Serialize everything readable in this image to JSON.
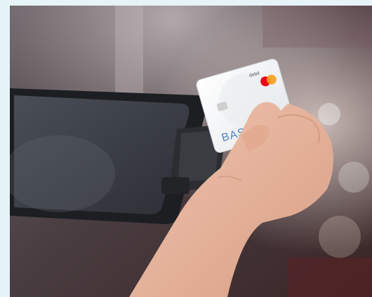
{
  "photo": {
    "card": {
      "brand_text": "BASIC",
      "type_text": "debit",
      "network_logo": "mastercard-logo"
    },
    "colors": {
      "page_background": "#e6f3f7",
      "tablet_body": "#1c1e22",
      "tablet_screen": "#3a3d44",
      "card_face": "#f2f3f5",
      "card_text": "#4a86c9",
      "logo_red": "#eb001b",
      "logo_orange": "#f79e1b",
      "skin": "#e7b59c"
    }
  }
}
